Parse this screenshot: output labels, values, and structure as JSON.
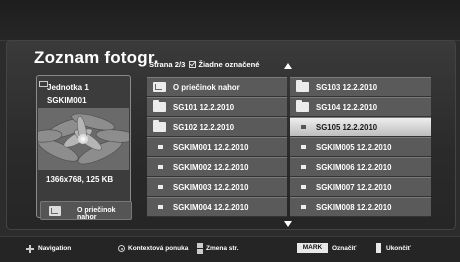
{
  "title": "Zoznam fotogr.",
  "page_info": {
    "page": "Strana 2/3",
    "selection": "Žiadne označené"
  },
  "preview": {
    "name": "Jednotka 1",
    "id": "SGKIM001",
    "info": "1366x768, 125 KB",
    "button_label": "O priečinok nahor"
  },
  "files": {
    "left": [
      {
        "label": "O priečinok nahor",
        "icon": "folder-up-icon",
        "selected": false
      },
      {
        "label": "SG101 12.2.2010",
        "icon": "folder-icon",
        "selected": false
      },
      {
        "label": "SG102 12.2.2010",
        "icon": "folder-icon",
        "selected": false
      },
      {
        "label": "SGKIM001 12.2.2010",
        "icon": "photo-file-icon",
        "selected": false
      },
      {
        "label": "SGKIM002 12.2.2010",
        "icon": "photo-file-icon",
        "selected": false
      },
      {
        "label": "SGKIM003 12.2.2010",
        "icon": "photo-file-icon",
        "selected": false
      },
      {
        "label": "SGKIM004 12.2.2010",
        "icon": "photo-file-icon",
        "selected": false
      }
    ],
    "right": [
      {
        "label": "SG103 12.2.2010",
        "icon": "folder-icon",
        "selected": false
      },
      {
        "label": "SG104 12.2.2010",
        "icon": "folder-icon",
        "selected": false
      },
      {
        "label": "SG105 12.2.2010",
        "icon": "photo-file-icon",
        "selected": true
      },
      {
        "label": "SGKIM005 12.2.2010",
        "icon": "photo-file-icon",
        "selected": false
      },
      {
        "label": "SGKIM006 12.2.2010",
        "icon": "photo-file-icon",
        "selected": false
      },
      {
        "label": "SGKIM007 12.2.2010",
        "icon": "photo-file-icon",
        "selected": false
      },
      {
        "label": "SGKIM008 12.2.2010",
        "icon": "photo-file-icon",
        "selected": false
      }
    ]
  },
  "bottom_bar": {
    "navigation": "Navigation",
    "context_menu": "Kontextová ponuka",
    "page_change": "Zmena str.",
    "mark_key": "MARK",
    "mark": "Označiť",
    "exit": "Ukončiť"
  },
  "colors": {
    "background": "#2c2c2c",
    "cell": "#5a5a5a",
    "selected_cell": "#d8d8d8"
  }
}
